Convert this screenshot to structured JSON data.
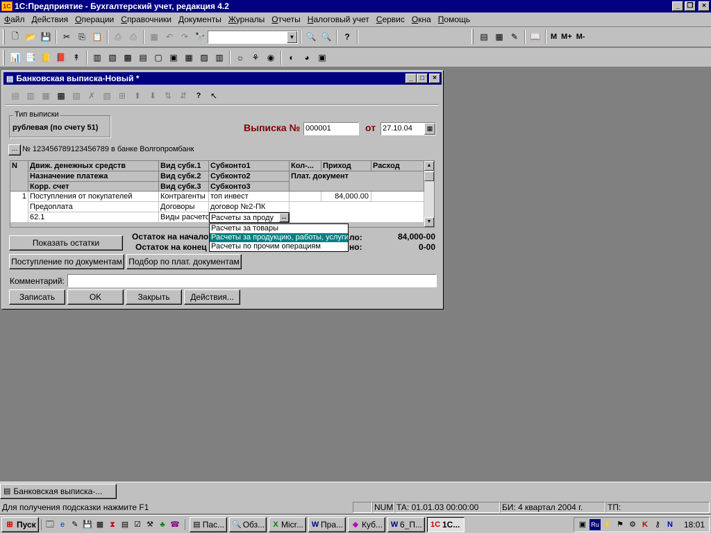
{
  "app": {
    "title": "1С:Предприятие - Бухгалтерский учет, редакция 4.2"
  },
  "menu": [
    "Файл",
    "Действия",
    "Операции",
    "Справочники",
    "Документы",
    "Журналы",
    "Отчеты",
    "Налоговый учет",
    "Сервис",
    "Окна",
    "Помощь"
  ],
  "toolbar": {
    "search_value": "",
    "m_labels": [
      "M",
      "M+",
      "M-"
    ]
  },
  "doc": {
    "title": "Банковская выписка-Новый *",
    "group_label": "Тип выписки",
    "group_value": "рублевая (по счету 51)",
    "heading": "Выписка №",
    "number": "000001",
    "from_label": "от",
    "date": "27.10.04",
    "account_btn": "...",
    "account_text": "№ 123456789123456789  в банке Волгопромбанк",
    "grid": {
      "headers": {
        "n": "N",
        "c1": [
          "Движ. денежных средств",
          "Назначение платежа",
          "Корр. счет"
        ],
        "c2": [
          "Вид субк.1",
          "Вид субк.2",
          "Вид субк.3"
        ],
        "c3": [
          "Субконто1",
          "Субконто2",
          "Субконто3"
        ],
        "c4": "Кол-...",
        "c5": "Приход",
        "c6": "Расход",
        "c45": "Плат.  документ"
      },
      "row": {
        "n": "1",
        "c1": [
          "Поступления от покупателей",
          "Предоплата",
          "62.1"
        ],
        "c2": [
          "Контрагенты",
          "Договоры",
          "Виды расчетов"
        ],
        "c3": [
          "топ инвест",
          "договор №2-ПК",
          "Расчеты за проду"
        ],
        "c4": "",
        "c5": "84,000.00",
        "c6": ""
      }
    },
    "dropdown": [
      "Расчеты за товары",
      "Расчеты за продукцию, работы, услуги",
      "Расчеты по прочим операциям"
    ],
    "show_balance_btn": "Показать остатки",
    "balance_start_label": "Остаток на начало",
    "balance_end_label": "Остаток на конец",
    "partial_label_1": "ло:",
    "partial_label_2": "но:",
    "balance_start_value": "84,000-00",
    "balance_end_value": "0-00",
    "receipt_docs_btn": "Поступление по документам",
    "select_docs_btn": "Подбор по плат. документам",
    "comment_label": "Комментарий:",
    "comment_value": "",
    "buttons": [
      "Записать",
      "OK",
      "Закрыть",
      "Действия..."
    ]
  },
  "taskwindow": "Банковская выписка-...",
  "status": {
    "hint": "Для получения подсказки нажмите F1",
    "num": "NUM",
    "ta": "ТА: 01.01.03  00:00:00",
    "bi": "БИ: 4 квартал 2004 г.",
    "tp": "ТП:"
  },
  "taskbar": {
    "start": "Пуск",
    "items": [
      "Пас...",
      "Обз...",
      "Micr...",
      "Пра...",
      "Куб...",
      "6_П...",
      "1С..."
    ],
    "clock": "18:01"
  }
}
